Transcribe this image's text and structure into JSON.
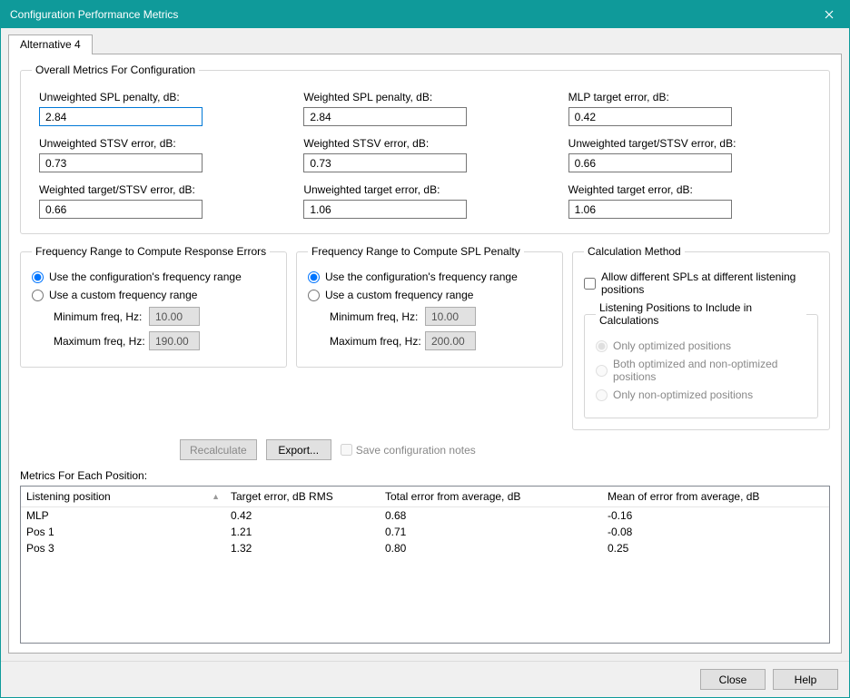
{
  "window": {
    "title": "Configuration Performance Metrics"
  },
  "tab": {
    "label": "Alternative 4"
  },
  "overall": {
    "legend": "Overall Metrics For Configuration",
    "items": [
      {
        "label": "Unweighted SPL penalty, dB:",
        "value": "2.84"
      },
      {
        "label": "Weighted SPL penalty, dB:",
        "value": "2.84"
      },
      {
        "label": "MLP target error, dB:",
        "value": "0.42"
      },
      {
        "label": "Unweighted STSV error, dB:",
        "value": "0.73"
      },
      {
        "label": "Weighted STSV error, dB:",
        "value": "0.73"
      },
      {
        "label": "Unweighted target/STSV error, dB:",
        "value": "0.66"
      },
      {
        "label": "Weighted target/STSV error, dB:",
        "value": "0.66"
      },
      {
        "label": "Unweighted target error, dB:",
        "value": "1.06"
      },
      {
        "label": "Weighted target error, dB:",
        "value": "1.06"
      }
    ]
  },
  "freqResp": {
    "legend": "Frequency Range to Compute Response Errors",
    "opt1": "Use the configuration's frequency range",
    "opt2": "Use a custom frequency range",
    "minLabel": "Minimum freq, Hz:",
    "maxLabel": "Maximum freq, Hz:",
    "min": "10.00",
    "max": "190.00"
  },
  "freqSpl": {
    "legend": "Frequency Range to Compute SPL Penalty",
    "opt1": "Use the configuration's frequency range",
    "opt2": "Use a custom frequency range",
    "minLabel": "Minimum freq, Hz:",
    "maxLabel": "Maximum freq, Hz:",
    "min": "10.00",
    "max": "200.00"
  },
  "calc": {
    "legend": "Calculation Method",
    "allowDiff": "Allow different SPLs at different listening positions",
    "subLegend": "Listening Positions to Include in Calculations",
    "opt1": "Only optimized positions",
    "opt2": "Both optimized and non-optimized positions",
    "opt3": "Only non-optimized positions"
  },
  "actions": {
    "recalc": "Recalculate",
    "export": "Export...",
    "saveNotes": "Save configuration notes"
  },
  "positions": {
    "label": "Metrics For Each Position:",
    "headers": [
      "Listening position",
      "Target error, dB RMS",
      "Total error from average, dB",
      "Mean of error from average, dB"
    ],
    "rows": [
      {
        "pos": "MLP",
        "target": "0.42",
        "total": "0.68",
        "mean": "-0.16"
      },
      {
        "pos": "Pos 1",
        "target": "1.21",
        "total": "0.71",
        "mean": "-0.08"
      },
      {
        "pos": "Pos 3",
        "target": "1.32",
        "total": "0.80",
        "mean": "0.25"
      }
    ]
  },
  "footer": {
    "close": "Close",
    "help": "Help"
  }
}
